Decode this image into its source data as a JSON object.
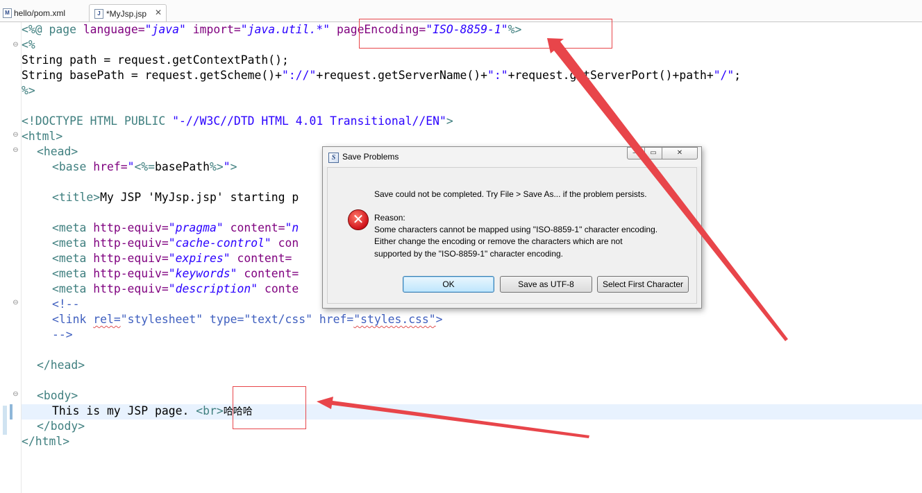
{
  "tabs": [
    {
      "label": "hello/pom.xml",
      "icon": "maven-file-icon",
      "active": false
    },
    {
      "label": "*MyJsp.jsp",
      "icon": "jsp-file-icon",
      "active": true,
      "close": "✕"
    }
  ],
  "editor": {
    "lines": {
      "l1": {
        "a": "<%@ page ",
        "b": "language=",
        "c": "\"java\"",
        "d": " import=",
        "e": "\"java.util.*\"",
        "f": " pageEncoding=",
        "g": "\"ISO-8859-1\"",
        "h": "%>"
      },
      "l2": "<%",
      "l3": "String path = request.getContextPath();",
      "l4a": "String basePath = request.getScheme()+",
      "l4b": "\"://\"",
      "l4c": "+request.getServerName()+",
      "l4d": "\":\"",
      "l4e": "+request.getServerPort()+path+",
      "l4f": "\"/\"",
      "l4g": ";",
      "l5": "%>",
      "l7a": "<!DOCTYPE HTML PUBLIC ",
      "l7b": "\"-//W3C//DTD HTML 4.01 Transitional//EN\"",
      "l7c": ">",
      "l8": "<html>",
      "l9": "<head>",
      "l10a": "<base ",
      "l10b": "href=",
      "l10c": "\"",
      "l10d": "<%=",
      "l10e": "basePath",
      "l10f": "%>",
      "l10g": "\"",
      "l10h": ">",
      "l12a": "<title>",
      "l12b": "My JSP 'MyJsp.jsp' starting p",
      "m1a": "<meta ",
      "m1b": "http-equiv=",
      "m1c": "\"pragma\"",
      "m1d": " content=",
      "m1e": "\"n",
      "m2a": "<meta ",
      "m2b": "http-equiv=",
      "m2c": "\"cache-control\"",
      "m2d": " con",
      "m3a": "<meta ",
      "m3b": "http-equiv=",
      "m3c": "\"expires\"",
      "m3d": " content=",
      "m4a": "<meta ",
      "m4b": "http-equiv=",
      "m4c": "\"keywords\"",
      "m4d": " content=",
      "m5a": "<meta ",
      "m5b": "http-equiv=",
      "m5c": "\"description\"",
      "m5d": " conte",
      "c1": "<!--",
      "lk1": "<link ",
      "lk2": "rel=",
      "lk3": "\"stylesheet\"",
      "lk4": " type=",
      "lk5": "\"text/css\"",
      "lk6": " href=",
      "lk7": "\"styles.css\"",
      "lk8": ">",
      "c2": "-->",
      "h2": "</head>",
      "b1": "<body>",
      "b2a": "This is my JSP page. ",
      "b2b": "<br>",
      "b2c": "哈哈哈",
      "b3": "</body>",
      "b4": "</html>"
    }
  },
  "dialog": {
    "title": "Save Problems",
    "icon": "eclipse-icon",
    "window_buttons": {
      "minimize": "—",
      "maximize": "▭",
      "close": "✕"
    },
    "error_icon": "error-icon",
    "message": "Save could not be completed. Try File > Save As... if the problem persists.",
    "reason_label": "Reason:",
    "reason_lines": [
      "Some characters cannot be mapped using \"ISO-8859-1\" character encoding.",
      "Either change the encoding or remove the characters which are not",
      "supported by the \"ISO-8859-1\" character encoding."
    ],
    "buttons": {
      "ok": "OK",
      "save_utf8": "Save as UTF-8",
      "select_first": "Select First Character"
    }
  },
  "annotation_color": "#e8454a"
}
